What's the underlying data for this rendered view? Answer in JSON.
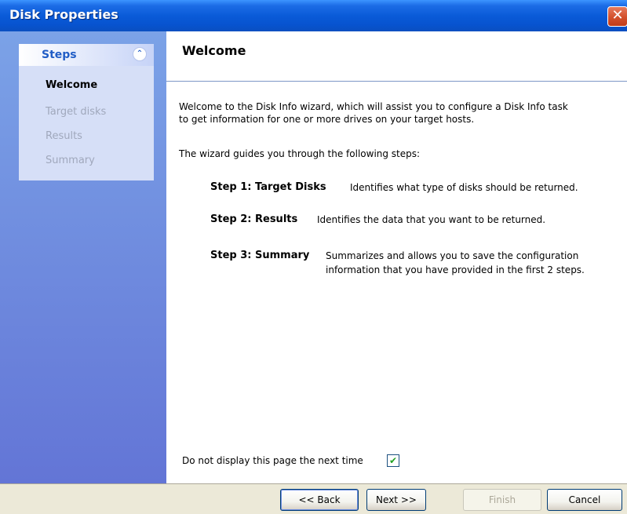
{
  "window": {
    "title": "Disk Properties",
    "close_label": "✕"
  },
  "sidebar": {
    "panel_title": "Steps",
    "collapse_glyph": "⌃",
    "items": [
      {
        "label": "Welcome",
        "state": "active"
      },
      {
        "label": "Target disks",
        "state": "disabled"
      },
      {
        "label": "Results",
        "state": "disabled"
      },
      {
        "label": "Summary",
        "state": "disabled"
      }
    ]
  },
  "main": {
    "title": "Welcome",
    "intro_line1": "Welcome to the Disk Info wizard, which will assist you to configure a Disk Info task",
    "intro_line2": "to get information for one or more drives on your target hosts.",
    "guide_text": "The wizard guides you through the following steps:",
    "steps": [
      {
        "label": "Step 1: Target Disks",
        "desc": "Identifies what type of disks should be returned."
      },
      {
        "label": "Step 2: Results",
        "desc": "Identifies the data that you want to be returned."
      },
      {
        "label": "Step 3: Summary",
        "desc_line1": "Summarizes and allows you to save the configuration",
        "desc_line2": "information that you have provided in the first 2 steps."
      }
    ],
    "checkbox_label": "Do not display this page the next time",
    "checkbox_checked": true,
    "checkbox_glyph": "✔"
  },
  "footer": {
    "back_label": "<< Back",
    "next_label": "Next >>",
    "finish_label": "Finish",
    "cancel_label": "Cancel"
  },
  "colors": {
    "titlebar": "#0A5BD8",
    "sidebar": "#6E8CDC",
    "accent_text": "#215DC6",
    "disabled_text": "#A0A8BC"
  }
}
